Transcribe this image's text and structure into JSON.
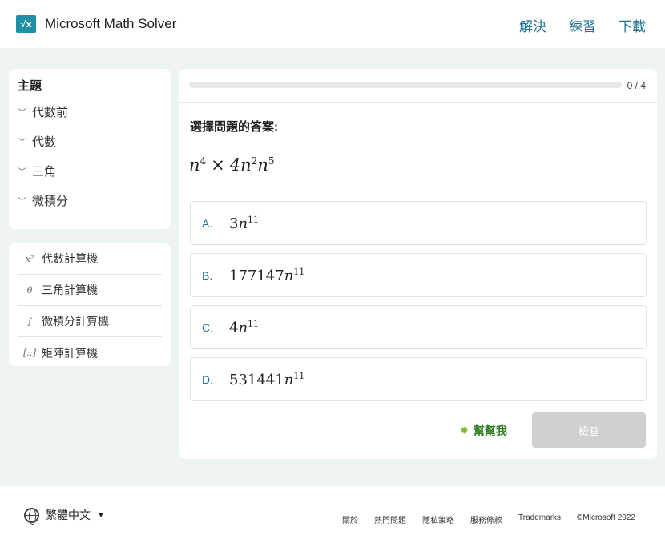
{
  "header": {
    "logo_text": "√x",
    "app_title": "Microsoft Math Solver",
    "nav": [
      "解決",
      "練習",
      "下載"
    ]
  },
  "sidebar": {
    "topics_title": "主題",
    "topics": [
      "代數前",
      "代數",
      "三角",
      "微積分"
    ],
    "tools": [
      {
        "icon": "x-squared-icon",
        "glyph": "x²",
        "label": "代數計算機"
      },
      {
        "icon": "theta-icon",
        "glyph": "θ",
        "label": "三角計算機"
      },
      {
        "icon": "integral-icon",
        "glyph": "∫",
        "label": "微積分計算機"
      },
      {
        "icon": "matrix-icon",
        "glyph": "[::]",
        "label": "矩陣計算機"
      }
    ]
  },
  "quiz": {
    "progress_text": "0 / 4",
    "progress_fraction": 0,
    "prompt": "選擇問題的答案:",
    "expression": {
      "a": "n",
      "a_exp": "4",
      "op": "×",
      "b": "4n",
      "b_exp": "2",
      "c": "n",
      "c_exp": "5"
    },
    "options": [
      {
        "letter": "A.",
        "coef": "3",
        "var": "n",
        "exp": "11"
      },
      {
        "letter": "B.",
        "coef": "177147",
        "var": "n",
        "exp": "11"
      },
      {
        "letter": "C.",
        "coef": "4",
        "var": "n",
        "exp": "11"
      },
      {
        "letter": "D.",
        "coef": "531441",
        "var": "n",
        "exp": "11"
      }
    ],
    "help_label": "幫幫我",
    "check_label": "檢查"
  },
  "footer": {
    "language": "繁體中文",
    "links": [
      "關於",
      "熱門問題",
      "隱私策略",
      "服務條款",
      "Trademarks",
      "©Microsoft 2022"
    ]
  },
  "colors": {
    "accent": "#1e7390",
    "logo": "#1f8fa6",
    "help": "#2e7d1f",
    "disabled_button": "#d0d0d0"
  }
}
